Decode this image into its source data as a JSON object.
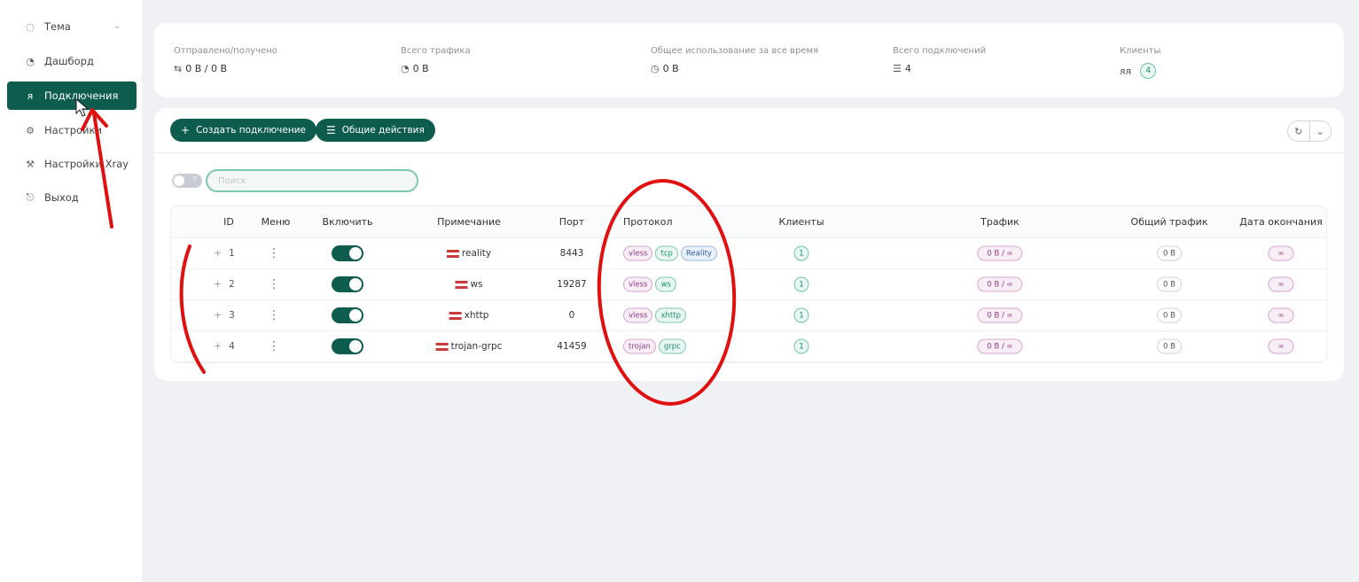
{
  "sidebar": {
    "items": [
      {
        "label": "Тема",
        "icon": "bulb-icon"
      },
      {
        "label": "Дашборд",
        "icon": "dashboard-icon"
      },
      {
        "label": "Подключения",
        "icon": "user-icon",
        "active": true
      },
      {
        "label": "Настройки",
        "icon": "gear-icon"
      },
      {
        "label": "Настройки Xray",
        "icon": "tool-icon"
      },
      {
        "label": "Выход",
        "icon": "logout-icon"
      }
    ]
  },
  "stats": {
    "sent_received": {
      "label": "Отправлено/получено",
      "value": "0 B / 0 B"
    },
    "total_traffic": {
      "label": "Всего трафика",
      "value": "0 B"
    },
    "all_time": {
      "label": "Общее использование за все время",
      "value": "0 B"
    },
    "total_inbounds": {
      "label": "Всего подключений",
      "value": "4"
    },
    "clients": {
      "label": "Клиенты",
      "value": "4"
    }
  },
  "toolbar": {
    "create_label": "Создать подключение",
    "general_label": "Общие действия"
  },
  "search": {
    "placeholder": "Поиск"
  },
  "table": {
    "headers": {
      "id": "ID",
      "menu": "Меню",
      "enable": "Включить",
      "remark": "Примечание",
      "port": "Порт",
      "protocol": "Протокол",
      "clients": "Клиенты",
      "traffic": "Трафик",
      "all_time": "Общий трафик",
      "expiry": "Дата окончания"
    },
    "rows": [
      {
        "id": "1",
        "remark": "reality",
        "port": "8443",
        "tags": [
          "vless",
          "tcp",
          "Reality"
        ],
        "clients": "1",
        "traffic": "0 B / ∞",
        "all_time": "0 B",
        "expiry": "∞"
      },
      {
        "id": "2",
        "remark": "ws",
        "port": "19287",
        "tags": [
          "vless",
          "ws"
        ],
        "clients": "1",
        "traffic": "0 B / ∞",
        "all_time": "0 B",
        "expiry": "∞"
      },
      {
        "id": "3",
        "remark": "xhttp",
        "port": "0",
        "tags": [
          "vless",
          "xhttp"
        ],
        "clients": "1",
        "traffic": "0 B / ∞",
        "all_time": "0 B",
        "expiry": "∞"
      },
      {
        "id": "4",
        "remark": "trojan-grpc",
        "port": "41459",
        "tags": [
          "trojan",
          "grpc"
        ],
        "clients": "1",
        "traffic": "0 B / ∞",
        "all_time": "0 B",
        "expiry": "∞"
      }
    ]
  },
  "colors": {
    "accent": "#0d5c4d",
    "annotation": "#e01010"
  }
}
